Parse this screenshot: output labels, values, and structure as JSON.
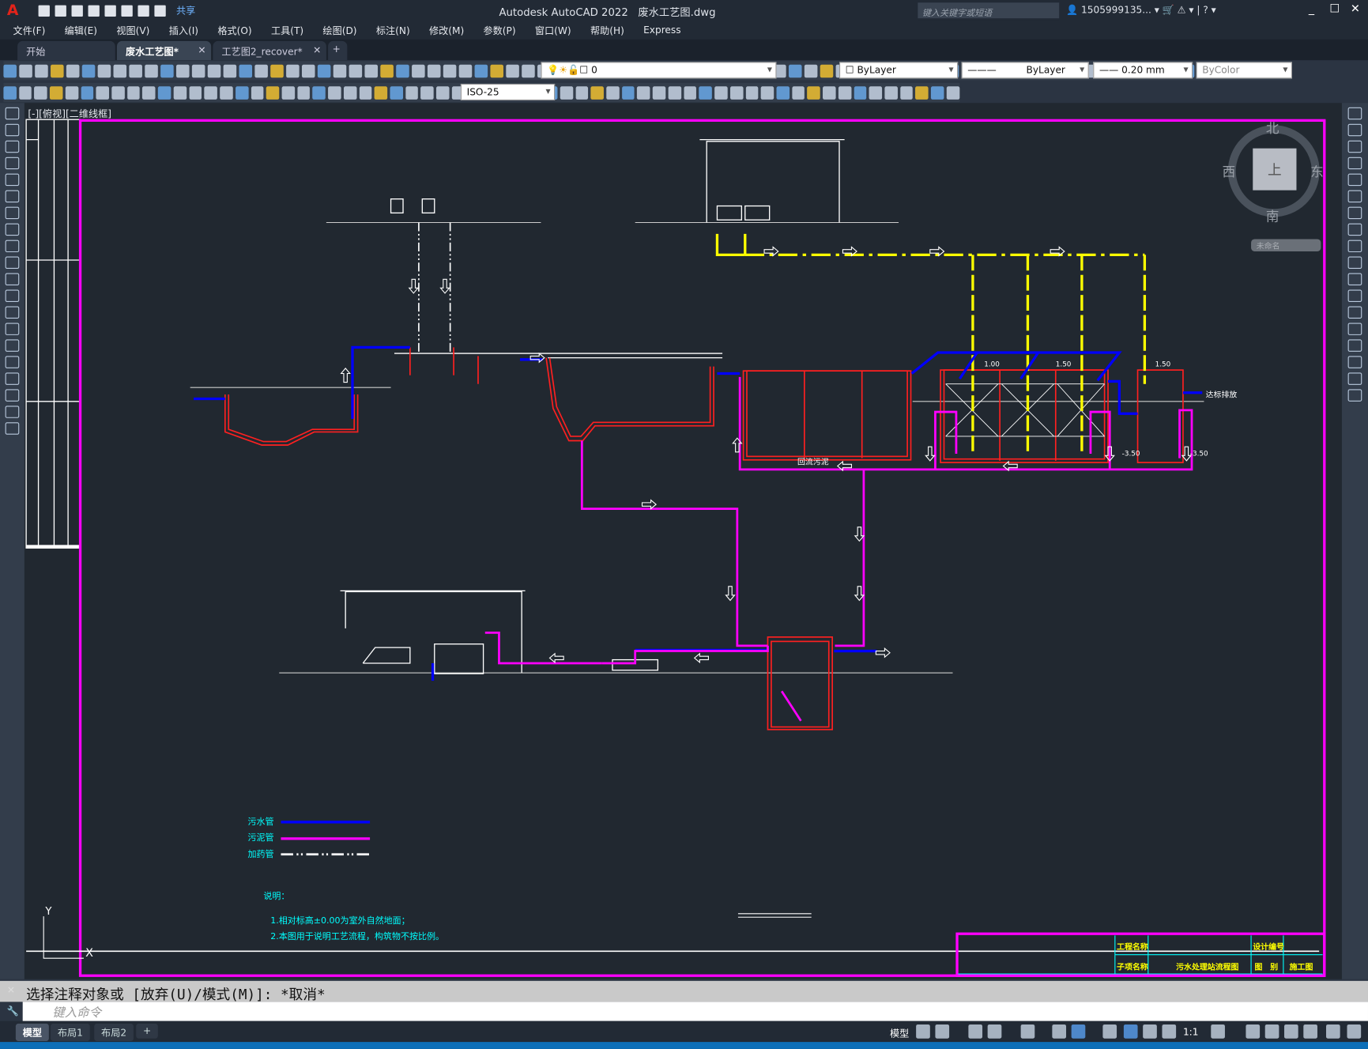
{
  "app": {
    "title": "Autodesk AutoCAD 2022",
    "file": "废水工艺图.dwg",
    "share": "共享",
    "search_placeholder": "键入关键字或短语",
    "user": "1505999135...",
    "logo": "A"
  },
  "menu": [
    "文件(F)",
    "编辑(E)",
    "视图(V)",
    "插入(I)",
    "格式(O)",
    "工具(T)",
    "绘图(D)",
    "标注(N)",
    "修改(M)",
    "参数(P)",
    "窗口(W)",
    "帮助(H)",
    "Express"
  ],
  "tabs": [
    {
      "label": "开始"
    },
    {
      "label": "废水工艺图*",
      "active": true
    },
    {
      "label": "工艺图2_recover*"
    }
  ],
  "toolbar": {
    "layer": "0",
    "color": "ByLayer",
    "linetype": "ByLayer",
    "lineweight": "0.20 mm",
    "plotstyle": "ByColor",
    "dimstyle": "ISO-25"
  },
  "viewport": {
    "label": "[-][俯视][二维线框]"
  },
  "viewcube": {
    "north": "北",
    "south": "南",
    "west": "西",
    "east": "东",
    "face": "上",
    "ucs": "未命名"
  },
  "drawing": {
    "legend": [
      {
        "label": "污水管",
        "color": "#0000ff"
      },
      {
        "label": "污泥管",
        "color": "#ff00ff"
      },
      {
        "label": "加药管",
        "color": "#ffffff"
      }
    ],
    "notes_title": "说明：",
    "notes": [
      "1.相对标高±0.00为室外自然地面；",
      "2.本图用于说明工艺流程，构筑物不按比例。"
    ],
    "return_sludge": "回流污泥",
    "discharge": "达标排放",
    "elevations": [
      "1.00",
      "1.50",
      "1.50",
      "-3.50",
      "-3.50"
    ],
    "title_block": {
      "project_label": "工程名称",
      "design_no_label": "设计编号",
      "sub_label": "子项名称",
      "sub_value": "污水处理站流程图",
      "type_label": "图　别",
      "type_value": "施工图"
    },
    "colors": {
      "sewage": "#0000ff",
      "sludge": "#ff00ff",
      "dosing": "#ffff00",
      "structure": "#ff0000",
      "frame": "#ff00ff",
      "text": "#00ffff"
    }
  },
  "command": {
    "history": "选择注释对象或 [放弃(U)/模式(M)]: *取消*",
    "placeholder": "键入命令"
  },
  "layouts": [
    "模型",
    "布局1",
    "布局2"
  ],
  "status": {
    "model": "模型",
    "scale": "1:1"
  }
}
